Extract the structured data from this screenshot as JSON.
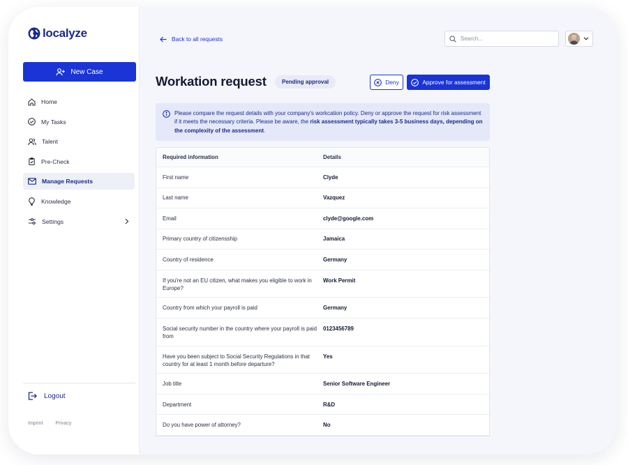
{
  "brand": {
    "name": "localyze"
  },
  "sidebar": {
    "new_case_label": "New Case",
    "items": [
      {
        "label": "Home",
        "icon": "home-icon"
      },
      {
        "label": "My Tasks",
        "icon": "check-circle-icon"
      },
      {
        "label": "Talent",
        "icon": "users-icon"
      },
      {
        "label": "Pre-Check",
        "icon": "clipboard-icon"
      },
      {
        "label": "Manage Requests",
        "icon": "mail-icon",
        "active": true
      },
      {
        "label": "Knowledge",
        "icon": "lightbulb-icon"
      },
      {
        "label": "Settings",
        "icon": "sliders-icon"
      }
    ],
    "logout_label": "Logout",
    "footer": {
      "imprint": "Imprint",
      "privacy": "Privacy"
    }
  },
  "header": {
    "back_label": "Back to all requests",
    "search_placeholder": "Search..."
  },
  "page": {
    "title": "Workation request",
    "status_badge": "Pending approval",
    "deny_label": "Deny",
    "approve_label": "Approve for assessment"
  },
  "info": {
    "text_1": "Please compare the request details with your company's workcation policy. Deny or approve the request for risk assessment if it meets the necessary criteria. Please be aware, the ",
    "text_bold": "risk assessment typically takes 3-5 business days, depending on the complexity of the assessment",
    "text_2": "."
  },
  "table": {
    "headers": [
      "Required information",
      "Details"
    ],
    "rows": [
      {
        "label": "First name",
        "value": "Clyde"
      },
      {
        "label": "Last name",
        "value": "Vazquez"
      },
      {
        "label": "Email",
        "value": "clyde@google.com"
      },
      {
        "label": "Primary country of citizensship",
        "value": "Jamaica"
      },
      {
        "label": "Country of residence",
        "value": "Germany"
      },
      {
        "label": "If you're not an EU citizen, what makes you eligible to work in Europe?",
        "value": "Work Permit"
      },
      {
        "label": "Country from which your payroll is paid",
        "value": "Germany"
      },
      {
        "label": "Social security number in the country where your payroll is paid from",
        "value": "0123456789"
      },
      {
        "label": "Have you been subject to Social Security Regulations in that country for at least 1 month before departure?",
        "value": "Yes"
      },
      {
        "label": "Job title",
        "value": "Senior Software Engineer"
      },
      {
        "label": "Department",
        "value": "R&D"
      },
      {
        "label": "Do you have power of attorney?",
        "value": "No"
      }
    ]
  },
  "colors": {
    "primary": "#1a34d6",
    "brand_dark": "#1b2a8c",
    "info_bg": "#e5e8f8"
  }
}
